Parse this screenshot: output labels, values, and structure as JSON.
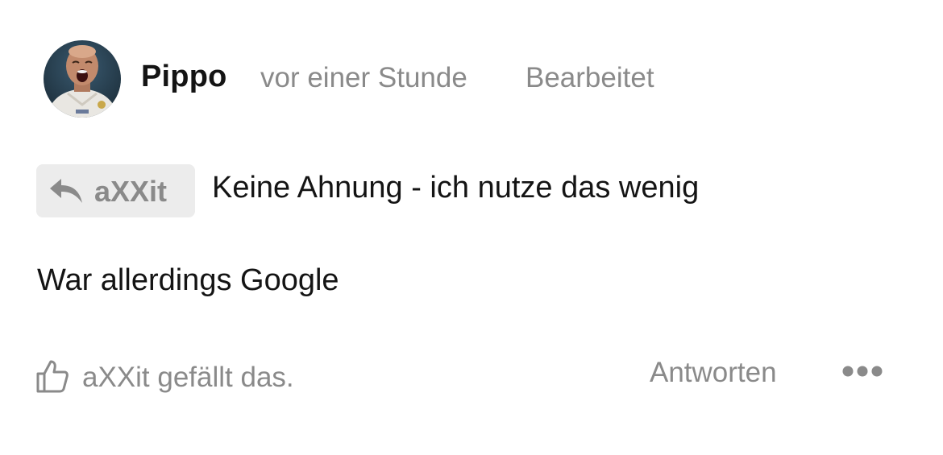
{
  "post": {
    "author": "Pippo",
    "time": "vor einer Stunde",
    "edited_label": "Bearbeitet",
    "quote": {
      "user": "aXXit",
      "text": "Keine Ahnung - ich nutze das wenig"
    },
    "body": "War allerdings Google",
    "likes_text": "aXXit gefällt das.",
    "reply_label": "Antworten"
  },
  "icons": {
    "avatar": "avatar-photo",
    "quote": "reply-arrow-icon",
    "like": "thumbs-up-icon",
    "more": "more-dots-icon"
  },
  "colors": {
    "text": "#141414",
    "muted": "#8a8a8a",
    "chip_bg": "#ececec",
    "background": "#ffffff"
  }
}
